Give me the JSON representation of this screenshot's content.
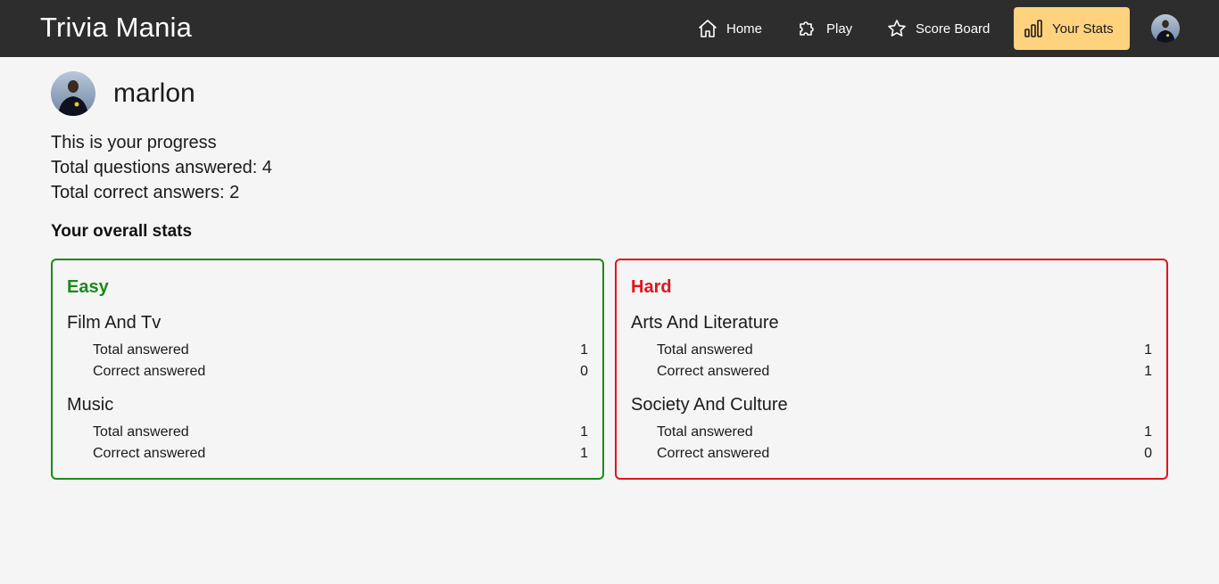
{
  "header": {
    "brand": "Trivia Mania",
    "nav": [
      {
        "label": "Home",
        "icon": "home-icon"
      },
      {
        "label": "Play",
        "icon": "puzzle-icon"
      },
      {
        "label": "Score Board",
        "icon": "star-icon"
      },
      {
        "label": "Your Stats",
        "icon": "bar-chart-icon",
        "active": true
      }
    ]
  },
  "profile": {
    "username": "marlon"
  },
  "progress": {
    "intro": "This is your progress",
    "total_questions": "Total questions answered: 4",
    "total_correct": "Total correct answers: 2"
  },
  "overall_title": "Your overall stats",
  "cards": {
    "easy": {
      "title": "Easy",
      "color": "#1a8a1a",
      "categories": [
        {
          "name": "Film And Tv",
          "total_label": "Total answered",
          "total": "1",
          "correct_label": "Correct answered",
          "correct": "0"
        },
        {
          "name": "Music",
          "total_label": "Total answered",
          "total": "1",
          "correct_label": "Correct answered",
          "correct": "1"
        }
      ]
    },
    "hard": {
      "title": "Hard",
      "color": "#e0141c",
      "categories": [
        {
          "name": "Arts And Literature",
          "total_label": "Total answered",
          "total": "1",
          "correct_label": "Correct answered",
          "correct": "1"
        },
        {
          "name": "Society And Culture",
          "total_label": "Total answered",
          "total": "1",
          "correct_label": "Correct answered",
          "correct": "0"
        }
      ]
    }
  },
  "colors": {
    "navbar": "#2d2d2d",
    "active_nav": "#ffd27d",
    "background": "#f5f5f5"
  }
}
